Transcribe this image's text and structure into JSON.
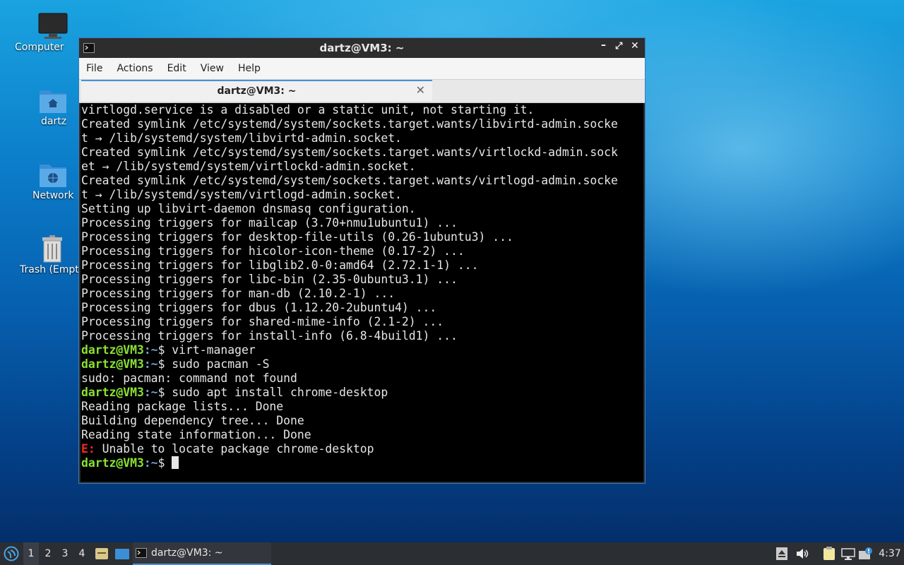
{
  "desktop": {
    "icons": [
      {
        "label": "Computer"
      },
      {
        "label": "dartz"
      },
      {
        "label": "Network"
      },
      {
        "label": "Trash (Empt"
      }
    ]
  },
  "window": {
    "title": "dartz@VM3: ~",
    "menu": [
      "File",
      "Actions",
      "Edit",
      "View",
      "Help"
    ],
    "tab_label": "dartz@VM3: ~",
    "prompt_user": "dartz@VM3",
    "prompt_path": ":~",
    "lines": [
      {
        "type": "out",
        "text": "virtlogd.service is a disabled or a static unit, not starting it."
      },
      {
        "type": "out",
        "text": "Created symlink /etc/systemd/system/sockets.target.wants/libvirtd-admin.socke"
      },
      {
        "type": "out",
        "text": "t → /lib/systemd/system/libvirtd-admin.socket."
      },
      {
        "type": "out",
        "text": "Created symlink /etc/systemd/system/sockets.target.wants/virtlockd-admin.sock"
      },
      {
        "type": "out",
        "text": "et → /lib/systemd/system/virtlockd-admin.socket."
      },
      {
        "type": "out",
        "text": "Created symlink /etc/systemd/system/sockets.target.wants/virtlogd-admin.socke"
      },
      {
        "type": "out",
        "text": "t → /lib/systemd/system/virtlogd-admin.socket."
      },
      {
        "type": "out",
        "text": "Setting up libvirt-daemon dnsmasq configuration."
      },
      {
        "type": "out",
        "text": "Processing triggers for mailcap (3.70+nmu1ubuntu1) ..."
      },
      {
        "type": "out",
        "text": "Processing triggers for desktop-file-utils (0.26-1ubuntu3) ..."
      },
      {
        "type": "out",
        "text": "Processing triggers for hicolor-icon-theme (0.17-2) ..."
      },
      {
        "type": "out",
        "text": "Processing triggers for libglib2.0-0:amd64 (2.72.1-1) ..."
      },
      {
        "type": "out",
        "text": "Processing triggers for libc-bin (2.35-0ubuntu3.1) ..."
      },
      {
        "type": "out",
        "text": "Processing triggers for man-db (2.10.2-1) ..."
      },
      {
        "type": "out",
        "text": "Processing triggers for dbus (1.12.20-2ubuntu4) ..."
      },
      {
        "type": "out",
        "text": "Processing triggers for shared-mime-info (2.1-2) ..."
      },
      {
        "type": "out",
        "text": "Processing triggers for install-info (6.8-4build1) ..."
      },
      {
        "type": "prompt",
        "text": "$ virt-manager"
      },
      {
        "type": "prompt",
        "text": "$ sudo pacman -S"
      },
      {
        "type": "out",
        "text": "sudo: pacman: command not found"
      },
      {
        "type": "prompt",
        "text": "$ sudo apt install chrome-desktop"
      },
      {
        "type": "out",
        "text": "Reading package lists... Done"
      },
      {
        "type": "out",
        "text": "Building dependency tree... Done"
      },
      {
        "type": "out",
        "text": "Reading state information... Done"
      },
      {
        "type": "error",
        "prefix": "E:",
        "text": " Unable to locate package chrome-desktop"
      },
      {
        "type": "prompt",
        "text": "$ ",
        "cursor": true
      }
    ]
  },
  "taskbar": {
    "workspaces": [
      "1",
      "2",
      "3",
      "4"
    ],
    "active_workspace": "1",
    "task_label": "dartz@VM3: ~",
    "clock": "4:37"
  },
  "colors": {
    "prompt_user": "#8ae234",
    "prompt_path": "#729fcf",
    "error": "#ef2929",
    "accent": "#4a90d9"
  }
}
